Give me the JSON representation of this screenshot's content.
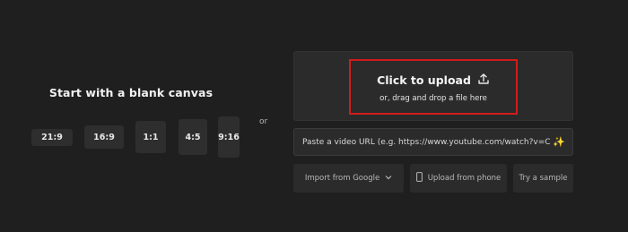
{
  "blank_canvas": {
    "title": "Start with a blank canvas",
    "ratios": [
      "21:9",
      "16:9",
      "1:1",
      "4:5",
      "9:16"
    ]
  },
  "or_label": "or",
  "upload": {
    "title": "Click to upload",
    "subtitle": "or, drag and drop a file here",
    "icon": "upload-icon"
  },
  "url_input": {
    "placeholder": "Paste a video URL (e.g. https://www.youtube.com/watch?v=C(",
    "icon": "sparkle-icon"
  },
  "actions": {
    "import_google": "Import from Google",
    "upload_phone": "Upload from phone",
    "try_sample": "Try a sample"
  },
  "colors": {
    "background": "#1f1f1f",
    "panel": "#2b2b2b",
    "highlight": "#d31b1b"
  }
}
